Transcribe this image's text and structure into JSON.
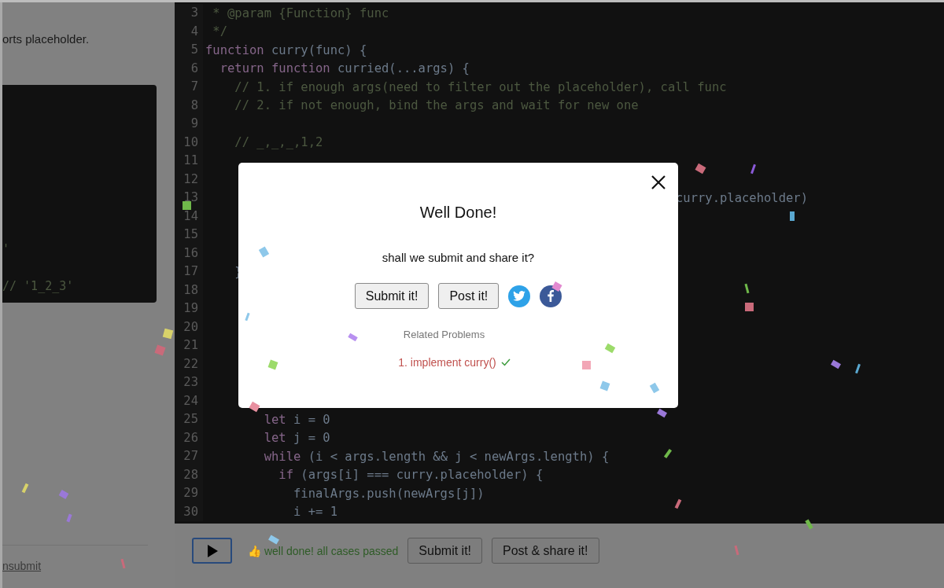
{
  "left_panel": {
    "description_fragment": "orts placeholder.",
    "example_lines": [
      {
        "text": "'"
      },
      {
        "text": "// '1_2_3'"
      }
    ],
    "link": "nsubmit"
  },
  "editor": {
    "lines": [
      {
        "number": "3",
        "tokens": [
          {
            "kind": "comment",
            "text": " * @param {Function} func"
          }
        ]
      },
      {
        "number": "4",
        "tokens": [
          {
            "kind": "comment",
            "text": " */"
          }
        ]
      },
      {
        "number": "5",
        "tokens": [
          {
            "kind": "keyword",
            "text": "function"
          },
          {
            "kind": "ident",
            "text": " curry(func) {"
          }
        ]
      },
      {
        "number": "6",
        "tokens": [
          {
            "kind": "keyword",
            "text": "  return function"
          },
          {
            "kind": "ident",
            "text": " curried(...args) {"
          }
        ]
      },
      {
        "number": "7",
        "tokens": [
          {
            "kind": "comment",
            "text": "    // 1. if enough args(need to filter out the placeholder), call func"
          }
        ]
      },
      {
        "number": "8",
        "tokens": [
          {
            "kind": "comment",
            "text": "    // 2. if not enough, bind the args and wait for new one"
          }
        ]
      },
      {
        "number": "9"
      },
      {
        "number": "10",
        "tokens": [
          {
            "kind": "comment",
            "text": "    // _,_,_,1,2"
          }
        ]
      },
      {
        "number": "11"
      },
      {
        "number": "12"
      },
      {
        "number": "13",
        "tail": "curry.placeholder)"
      },
      {
        "number": "14"
      },
      {
        "number": "15"
      },
      {
        "number": "16"
      },
      {
        "number": "17",
        "tokens": [
          {
            "kind": "ident",
            "text": "    }"
          }
        ]
      },
      {
        "number": "18"
      },
      {
        "number": "19"
      },
      {
        "number": "20"
      },
      {
        "number": "21"
      },
      {
        "number": "22"
      },
      {
        "number": "23"
      },
      {
        "number": "24"
      },
      {
        "number": "25",
        "tokens": [
          {
            "kind": "keyword",
            "text": "        let"
          },
          {
            "kind": "ident",
            "text": " i = 0"
          }
        ]
      },
      {
        "number": "26",
        "tokens": [
          {
            "kind": "keyword",
            "text": "        let"
          },
          {
            "kind": "ident",
            "text": " j = 0"
          }
        ]
      },
      {
        "number": "27",
        "tokens": [
          {
            "kind": "keyword",
            "text": "        while"
          },
          {
            "kind": "ident",
            "text": " (i < args.length && j < newArgs.length) {"
          }
        ]
      },
      {
        "number": "28",
        "tokens": [
          {
            "kind": "keyword",
            "text": "          if"
          },
          {
            "kind": "ident",
            "text": " (args[i] === curry.placeholder) {"
          }
        ]
      },
      {
        "number": "29",
        "tokens": [
          {
            "kind": "ident",
            "text": "            finalArgs.push(newArgs[j])"
          }
        ]
      },
      {
        "number": "30",
        "tokens": [
          {
            "kind": "ident",
            "text": "            i += 1"
          }
        ]
      }
    ]
  },
  "run_bar": {
    "status": "👍 well done! all cases passed",
    "buttons": [
      "Submit it!",
      "Post & share it!"
    ]
  },
  "dialog": {
    "title": "Well Done!",
    "message": "shall we submit and share it?",
    "buttons": [
      "Submit it!",
      "Post it!"
    ],
    "related_heading": "Related Problems",
    "related": [
      {
        "label": "1. implement curry()",
        "solved": true
      }
    ]
  }
}
